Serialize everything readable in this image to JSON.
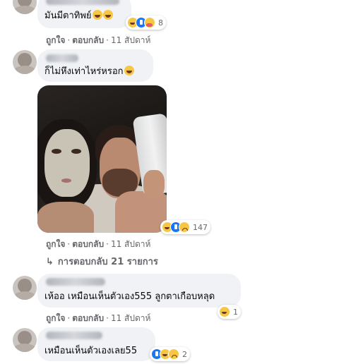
{
  "comments": [
    {
      "text": "มันมีตาทิพย์",
      "reaction_count": "8",
      "actions": {
        "like": "ถูกใจ",
        "reply": "ตอบกลับ",
        "time": "11 สัปดาห์"
      }
    },
    {
      "text": "ก็ไม่หึงเท่าไหร่หรอก",
      "reaction_count": "147",
      "actions": {
        "like": "ถูกใจ",
        "reply": "ตอบกลับ",
        "time": "11 สัปดาห์"
      },
      "replies_link": "การตอบกลับ 21 รายการ"
    },
    {
      "text": "เห้ออ เหมือนเห็นตัวเอง555 ลูกตาเกือบหลุด",
      "reaction_count": "1",
      "actions": {
        "like": "ถูกใจ",
        "reply": "ตอบกลับ",
        "time": "11 สัปดาห์"
      }
    },
    {
      "text": "เหมือนเห็นตัวเองเลย55",
      "reaction_count": "2"
    }
  ],
  "icons": {
    "haha": "haha-reaction-icon",
    "like": "like-reaction-icon",
    "care": "care-reaction-icon",
    "sad": "sad-reaction-icon",
    "reply_arrow": "reply-arrow-icon"
  },
  "colors": {
    "bubble": "#f0f2f5",
    "meta_text": "#65676b",
    "like_blue": "#1877f2",
    "emoji_yellow": "#f7c744"
  }
}
